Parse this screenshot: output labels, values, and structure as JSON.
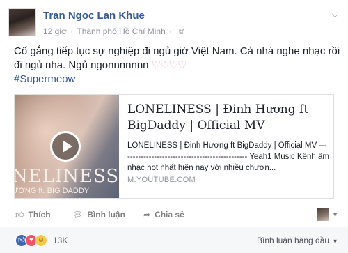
{
  "post": {
    "author": "Tran Ngoc Lan Khue",
    "time": "12 giờ",
    "separator": "·",
    "location": "Thành phố Hồ Chí Minh",
    "separator2": "·",
    "text": "Cố gắng tiếp tục sự nghiệp đi ngủ giờ Việt Nam. Cả nhà nghe nhạc rồi đi ngủ nha. Ngủ ngonnnnnnn",
    "hearts": "♡♡♡♡",
    "hashtag": "#Supermeow"
  },
  "link_card": {
    "thumb_title": "NELINESS",
    "thumb_subtitle": "ƯƠNG ft. BIG DADDY",
    "title": "LONELINESS | Đinh Hương ft BigDaddy | Official MV",
    "description": "LONELINESS | Đinh Hương ft BigDaddy | Official MV ------------------------------------------------ Yeah1 Music Kênh âm nhạc hot nhất hiện nay với nhiều chươn...",
    "domain": "M.YOUTUBE.COM"
  },
  "actions": {
    "like": "Thích",
    "comment": "Bình luận",
    "share": "Chia sẻ"
  },
  "reactions": {
    "count": "13K",
    "sort_label": "Bình luận hàng đầu"
  },
  "icons": {
    "globe": "globe-icon",
    "chevron": "chevron-down-icon",
    "play": "play-icon",
    "like": "thumbs-up-icon",
    "comment": "speech-bubble-icon",
    "share": "share-arrow-icon"
  },
  "colors": {
    "link": "#365899",
    "meta": "#90949c",
    "like_reaction": "#4267b2",
    "love_reaction": "#f25268",
    "haha_reaction": "#f7c948"
  }
}
